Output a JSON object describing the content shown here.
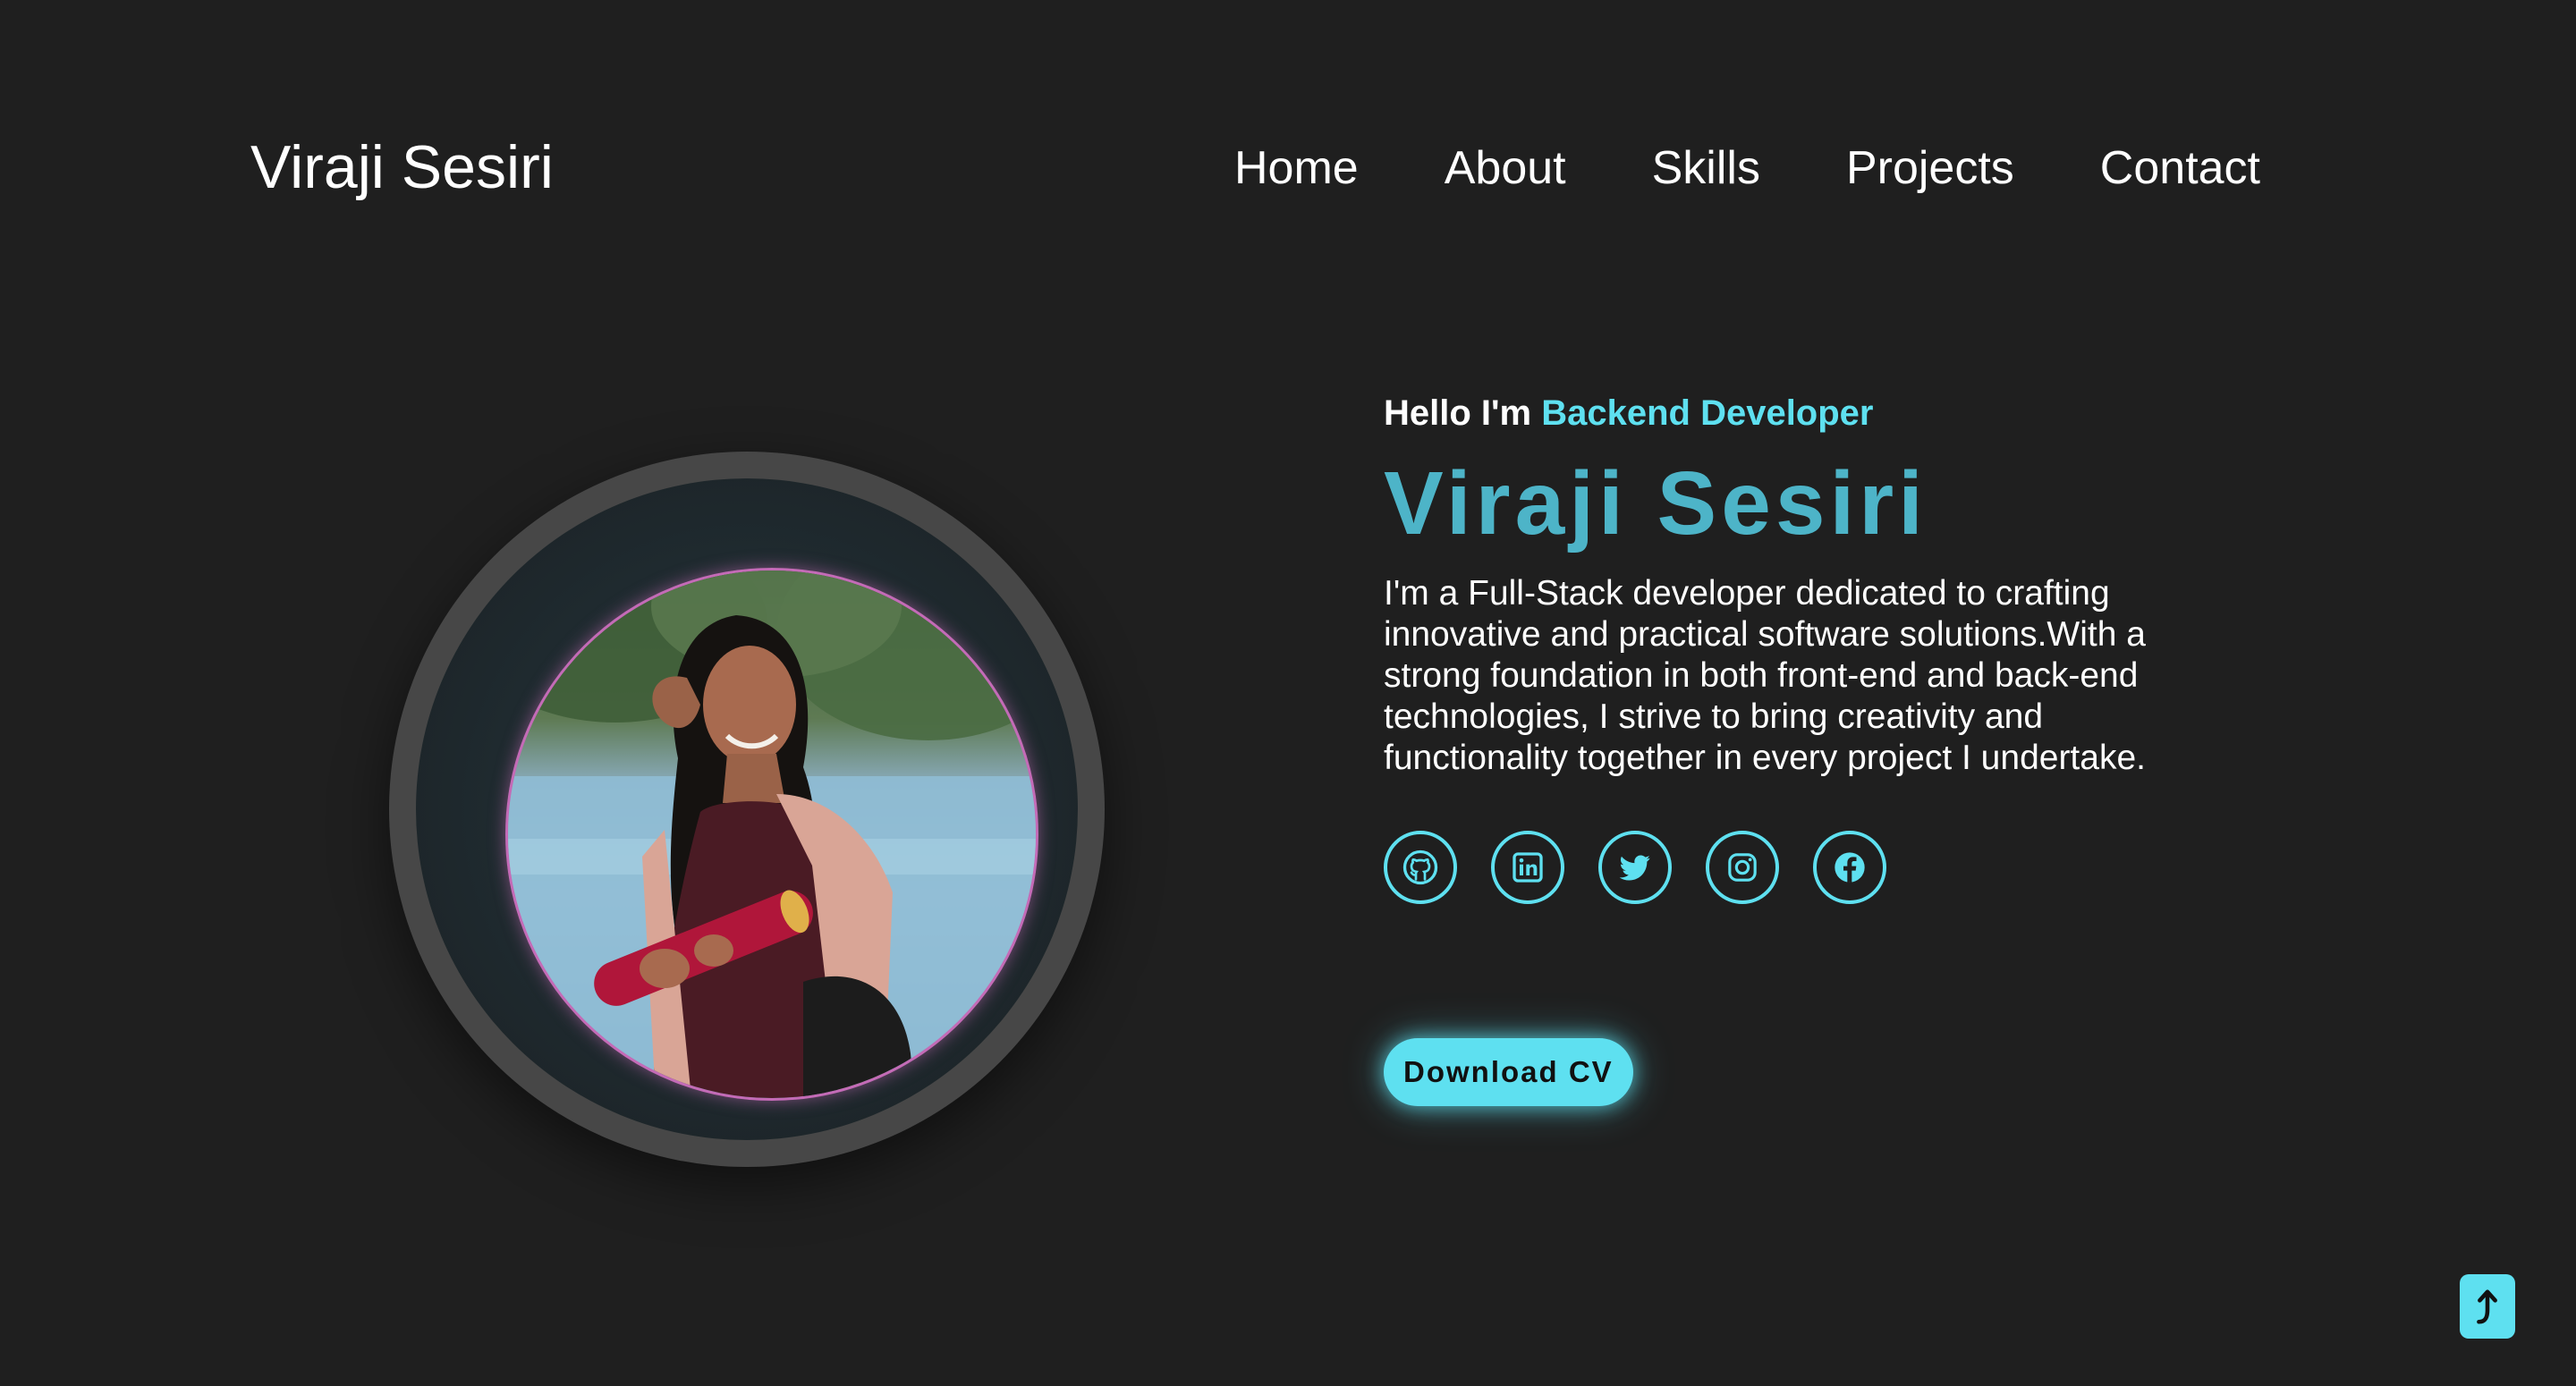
{
  "header": {
    "brand": "Viraji Sesiri",
    "nav": [
      "Home",
      "About",
      "Skills",
      "Projects",
      "Contact"
    ]
  },
  "hero": {
    "greeting_prefix": "Hello I'm ",
    "greeting_role": "Backend Developer",
    "name": "Viraji Sesiri",
    "bio": "I'm a Full-Stack developer dedicated to crafting innovative and practical software solutions.With a strong foundation in both front-end and back-end technologies, I strive to bring creativity and functionality together in every project I undertake.",
    "download_label": "Download CV"
  },
  "socials": [
    {
      "icon": "github-icon"
    },
    {
      "icon": "linkedin-icon"
    },
    {
      "icon": "twitter-icon"
    },
    {
      "icon": "instagram-icon"
    },
    {
      "icon": "facebook-icon"
    }
  ],
  "colors": {
    "background": "#1f1f1f",
    "accent": "#5ee0f0",
    "name": "#4db4c8",
    "photo_border": "#c46bb7"
  }
}
